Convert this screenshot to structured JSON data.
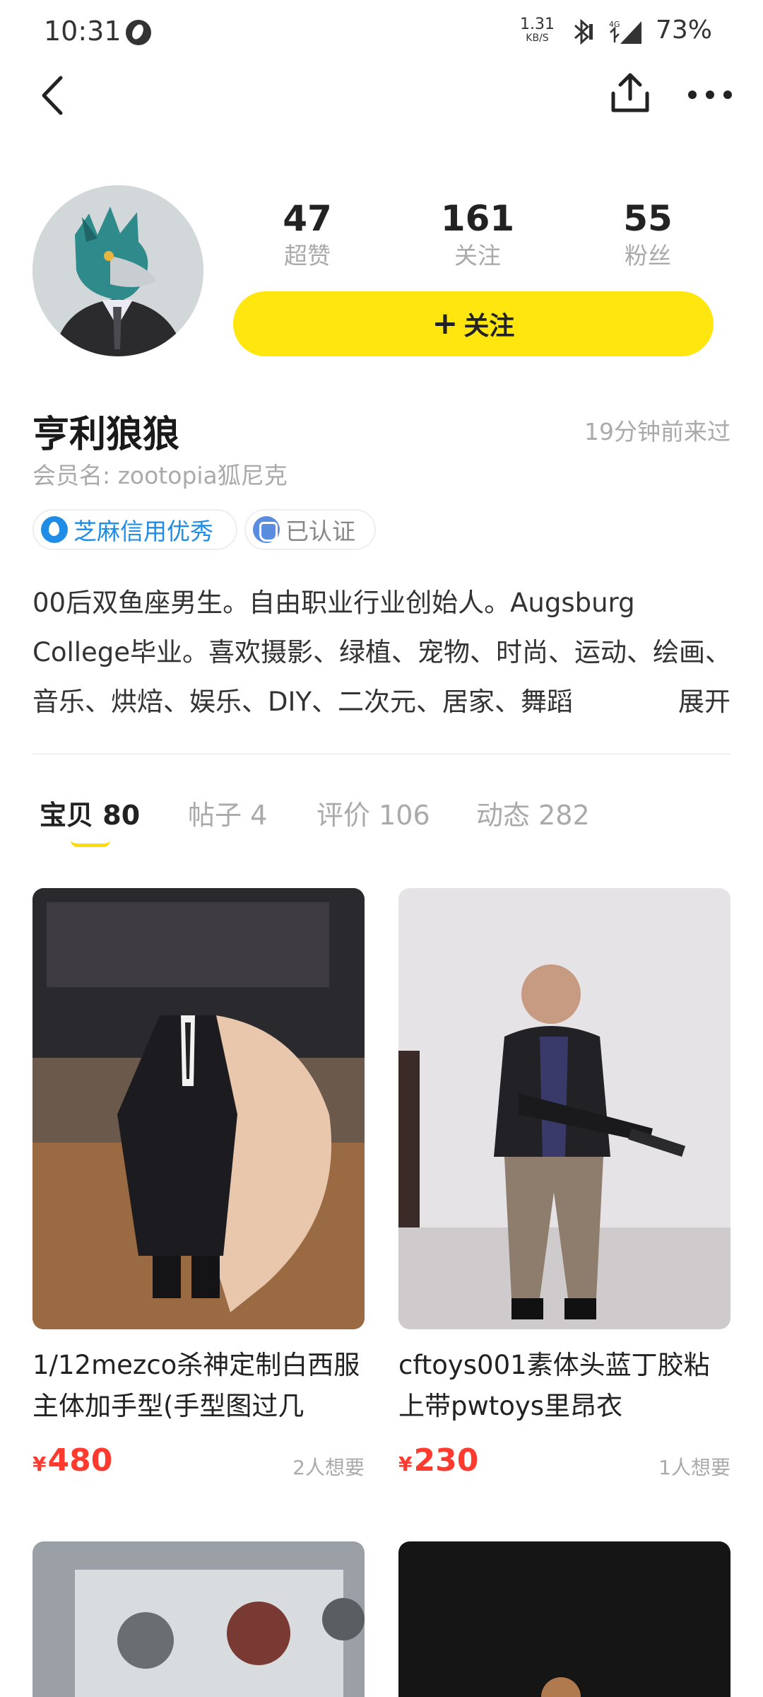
{
  "status_bar": {
    "time": "10:31",
    "net_speed_value": "1.31",
    "net_speed_unit": "KB/S",
    "network_label": "4G",
    "battery": "73%"
  },
  "profile": {
    "stats": [
      {
        "value": "47",
        "label": "超赞"
      },
      {
        "value": "161",
        "label": "关注"
      },
      {
        "value": "55",
        "label": "粉丝"
      }
    ],
    "follow_button": {
      "plus": "+",
      "label": "关注"
    },
    "username": "亨利狼狼",
    "last_seen": "19分钟前来过",
    "member_name": "会员名: zootopia狐尼克",
    "badges": {
      "credit": "芝麻信用优秀",
      "verified": "已认证"
    },
    "bio": "00后双鱼座男生。自由职业行业创始人。Augsburg College毕业。喜欢摄影、绿植、宠物、时尚、运动、绘画、音乐、烘焙、娱乐、DIY、二次元、居家、舞蹈",
    "bio_expand": "展开"
  },
  "tabs": [
    {
      "label": "宝贝",
      "count": "80"
    },
    {
      "label": "帖子",
      "count": "4"
    },
    {
      "label": "评价",
      "count": "106"
    },
    {
      "label": "动态",
      "count": "282"
    }
  ],
  "items": [
    {
      "title": "1/12mezco杀神定制白西服主体加手型(手型图过几",
      "currency": "¥",
      "price": "480",
      "wants": "2人想要"
    },
    {
      "title": "cftoys001素体头蓝丁胶粘上带pwtoys里昂衣",
      "currency": "¥",
      "price": "230",
      "wants": "1人想要"
    }
  ],
  "colors": {
    "accent_yellow": "#ffe60f",
    "price_red": "#ff3b30",
    "credit_blue": "#1f8ce6"
  }
}
